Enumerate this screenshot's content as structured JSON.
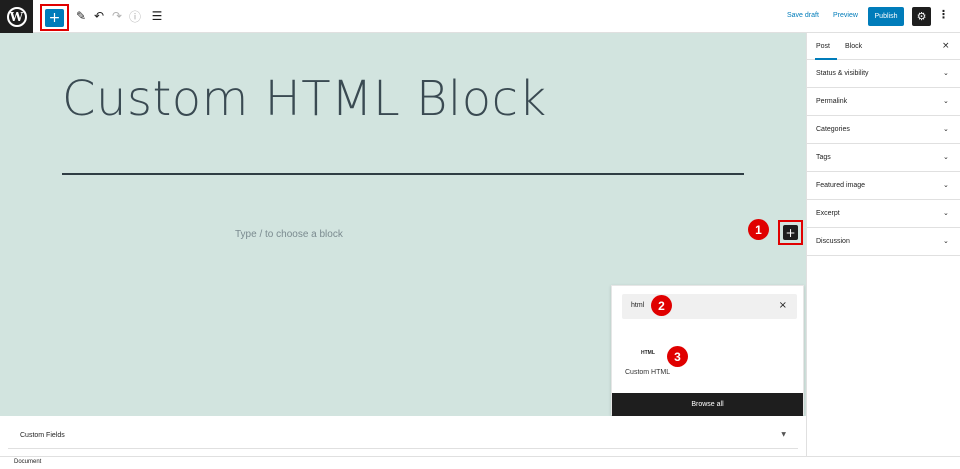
{
  "toolbar": {
    "logo_letter": "W",
    "inserter_icon": "+",
    "tools": [
      {
        "name": "edit-icon",
        "glyph": "✎"
      },
      {
        "name": "undo-icon",
        "glyph": "↶"
      },
      {
        "name": "redo-icon",
        "glyph": "↷"
      },
      {
        "name": "info-icon",
        "glyph": "ⓘ"
      },
      {
        "name": "list-view-icon",
        "glyph": "☰"
      }
    ],
    "save_draft": "Save draft",
    "preview": "Preview",
    "publish": "Publish",
    "settings_icon": "⚙",
    "more_icon": "⋮"
  },
  "editor": {
    "title": "Custom HTML Block",
    "block_prompt": "Type / to choose a block",
    "block_add_icon": "+"
  },
  "annotations": [
    "1",
    "2",
    "3"
  ],
  "inserter": {
    "search_value": "html",
    "clear_icon": "×",
    "result_icon_text": "HTML",
    "result_label": "Custom HTML",
    "browse_all": "Browse all"
  },
  "meta_boxes": {
    "label": "Custom Fields",
    "caret": "▼"
  },
  "footer": {
    "label": "Document"
  },
  "sidebar": {
    "tabs": [
      "Post",
      "Block"
    ],
    "close_icon": "×",
    "panels": [
      "Status & visibility",
      "Permalink",
      "Categories",
      "Tags",
      "Featured image",
      "Excerpt",
      "Discussion"
    ],
    "caret": "⌄"
  },
  "colors": {
    "accent": "#007cba",
    "canvas_bg": "#d2e4df",
    "highlight": "#e00000",
    "dark": "#1e1e1e"
  }
}
